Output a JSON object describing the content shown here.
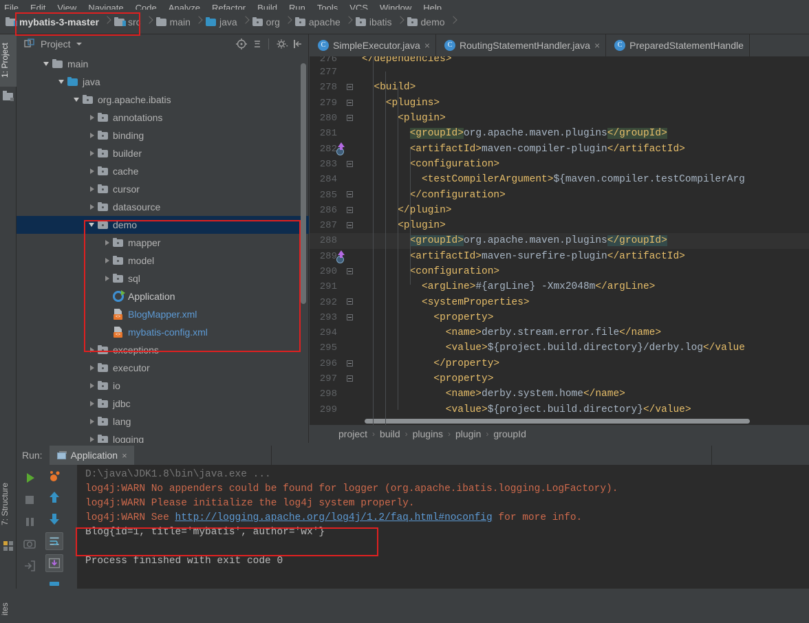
{
  "menubar": {
    "items": [
      "File",
      "Edit",
      "View",
      "Navigate",
      "Code",
      "Analyze",
      "Refactor",
      "Build",
      "Run",
      "Tools",
      "VCS",
      "Window",
      "Help"
    ]
  },
  "navbar": {
    "crumbs": [
      {
        "label": "mybatis-3-master",
        "icon": "module-folder-icon"
      },
      {
        "label": "src",
        "icon": "source-folder-icon"
      },
      {
        "label": "main",
        "icon": "folder-icon"
      },
      {
        "label": "java",
        "icon": "source-root-folder-icon"
      },
      {
        "label": "org",
        "icon": "package-icon"
      },
      {
        "label": "apache",
        "icon": "package-icon"
      },
      {
        "label": "ibatis",
        "icon": "package-icon"
      },
      {
        "label": "demo",
        "icon": "package-icon"
      }
    ]
  },
  "left_strip": {
    "project_tab": "1: Project",
    "structure_tab": "7: Structure",
    "favorites_tab": "ites"
  },
  "project_panel": {
    "title": "Project",
    "toolbar_icons": [
      "locate-target-icon",
      "collapse-all-icon",
      "settings-gear-icon",
      "hide-panel-icon"
    ],
    "tree": [
      {
        "label": "main",
        "indent": 1,
        "twist": "open",
        "icon": "folder-icon",
        "kind": "folder"
      },
      {
        "label": "java",
        "indent": 2,
        "twist": "open",
        "icon": "source-root-folder-icon",
        "kind": "sourceroot"
      },
      {
        "label": "org.apache.ibatis",
        "indent": 3,
        "twist": "open",
        "icon": "package-icon",
        "kind": "package"
      },
      {
        "label": "annotations",
        "indent": 4,
        "twist": "closed",
        "icon": "package-icon",
        "kind": "package"
      },
      {
        "label": "binding",
        "indent": 4,
        "twist": "closed",
        "icon": "package-icon",
        "kind": "package"
      },
      {
        "label": "builder",
        "indent": 4,
        "twist": "closed",
        "icon": "package-icon",
        "kind": "package"
      },
      {
        "label": "cache",
        "indent": 4,
        "twist": "closed",
        "icon": "package-icon",
        "kind": "package"
      },
      {
        "label": "cursor",
        "indent": 4,
        "twist": "closed",
        "icon": "package-icon",
        "kind": "package"
      },
      {
        "label": "datasource",
        "indent": 4,
        "twist": "closed",
        "icon": "package-icon",
        "kind": "package"
      },
      {
        "label": "demo",
        "indent": 4,
        "twist": "open",
        "icon": "package-icon",
        "kind": "package",
        "selected": true
      },
      {
        "label": "mapper",
        "indent": 5,
        "twist": "closed",
        "icon": "package-icon",
        "kind": "package"
      },
      {
        "label": "model",
        "indent": 5,
        "twist": "closed",
        "icon": "package-icon",
        "kind": "package"
      },
      {
        "label": "sql",
        "indent": 5,
        "twist": "closed",
        "icon": "package-icon",
        "kind": "package"
      },
      {
        "label": "Application",
        "indent": 5,
        "twist": "none",
        "icon": "java-class-run-icon",
        "kind": "class"
      },
      {
        "label": "BlogMapper.xml",
        "indent": 5,
        "twist": "none",
        "icon": "xml-file-icon",
        "kind": "xml"
      },
      {
        "label": "mybatis-config.xml",
        "indent": 5,
        "twist": "none",
        "icon": "xml-file-icon",
        "kind": "xml"
      },
      {
        "label": "exceptions",
        "indent": 4,
        "twist": "closed",
        "icon": "package-icon",
        "kind": "package"
      },
      {
        "label": "executor",
        "indent": 4,
        "twist": "closed",
        "icon": "package-icon",
        "kind": "package"
      },
      {
        "label": "io",
        "indent": 4,
        "twist": "closed",
        "icon": "package-icon",
        "kind": "package"
      },
      {
        "label": "jdbc",
        "indent": 4,
        "twist": "closed",
        "icon": "package-icon",
        "kind": "package"
      },
      {
        "label": "lang",
        "indent": 4,
        "twist": "closed",
        "icon": "package-icon",
        "kind": "package"
      },
      {
        "label": "logging",
        "indent": 4,
        "twist": "closed",
        "icon": "package-icon",
        "kind": "package"
      }
    ]
  },
  "editor": {
    "tabs": [
      {
        "label": "SimpleExecutor.java",
        "icon": "java-class-icon",
        "active": false
      },
      {
        "label": "RoutingStatementHandler.java",
        "icon": "java-class-icon",
        "active": false
      },
      {
        "label": "PreparedStatementHandle",
        "icon": "java-class-icon",
        "active": false
      }
    ],
    "breadcrumb": [
      "project",
      "build",
      "plugins",
      "plugin",
      "groupId"
    ],
    "lines": [
      {
        "num": "276",
        "indent": 0,
        "text": "</dependencies>",
        "clipped_top": true
      },
      {
        "num": "277",
        "indent": 0,
        "text": ""
      },
      {
        "num": "278",
        "indent": 2,
        "text": "<build>"
      },
      {
        "num": "279",
        "indent": 4,
        "text": "<plugins>"
      },
      {
        "num": "280",
        "indent": 6,
        "text": "<plugin>"
      },
      {
        "num": "281",
        "indent": 8,
        "text": "<groupId>org.apache.maven.plugins</groupId>",
        "highlight_tag": true
      },
      {
        "num": "282",
        "indent": 8,
        "text": "<artifactId>maven-compiler-plugin</artifactId>",
        "gutter": "override-marker"
      },
      {
        "num": "283",
        "indent": 8,
        "text": "<configuration>"
      },
      {
        "num": "284",
        "indent": 10,
        "text": "<testCompilerArgument>${maven.compiler.testCompilerArg"
      },
      {
        "num": "285",
        "indent": 8,
        "text": "</configuration>"
      },
      {
        "num": "286",
        "indent": 6,
        "text": "</plugin>"
      },
      {
        "num": "287",
        "indent": 6,
        "text": "<plugin>"
      },
      {
        "num": "288",
        "indent": 8,
        "text": "<groupId>org.apache.maven.plugins</groupId>",
        "current": true,
        "highlight_tag2": true
      },
      {
        "num": "289",
        "indent": 8,
        "text": "<artifactId>maven-surefire-plugin</artifactId>",
        "gutter": "override-marker"
      },
      {
        "num": "290",
        "indent": 8,
        "text": "<configuration>"
      },
      {
        "num": "291",
        "indent": 10,
        "text": "<argLine>#{argLine} -Xmx2048m</argLine>"
      },
      {
        "num": "292",
        "indent": 10,
        "text": "<systemProperties>"
      },
      {
        "num": "293",
        "indent": 12,
        "text": "<property>"
      },
      {
        "num": "294",
        "indent": 14,
        "text": "<name>derby.stream.error.file</name>"
      },
      {
        "num": "295",
        "indent": 14,
        "text": "<value>${project.build.directory}/derby.log</value"
      },
      {
        "num": "296",
        "indent": 12,
        "text": "</property>"
      },
      {
        "num": "297",
        "indent": 12,
        "text": "<property>"
      },
      {
        "num": "298",
        "indent": 14,
        "text": "<name>derby.system.home</name>"
      },
      {
        "num": "299",
        "indent": 14,
        "text": "<value>${project.build.directory}</value>"
      }
    ]
  },
  "run_panel": {
    "run_label": "Run:",
    "tab_label": "Application",
    "tab_close": "×",
    "toolbar_icons": [
      "rerun-play-icon",
      "stop-icon",
      "pause-icon",
      "camera-dump-icon",
      "exit-icon",
      "coverage-icon",
      "scroll-up-icon",
      "scroll-down-icon",
      "soft-wrap-icon",
      "scroll-to-end-icon",
      "print-icon"
    ],
    "console": [
      {
        "text": "D:\\java\\JDK1.8\\bin\\java.exe ...",
        "style": "dim"
      },
      {
        "text": "log4j:WARN No appenders could be found for logger (org.apache.ibatis.logging.LogFactory).",
        "style": "err"
      },
      {
        "text": "log4j:WARN Please initialize the log4j system properly.",
        "style": "err"
      },
      {
        "text": "log4j:WARN See ",
        "style": "err",
        "link": "http://logging.apache.org/log4j/1.2/faq.html#noconfig",
        "after": " for more info."
      },
      {
        "text": "Blog{id=1, title='mybatis', author='wx'}",
        "style": "out"
      },
      {
        "text": "",
        "style": "out"
      },
      {
        "text": "Process finished with exit code 0",
        "style": "out"
      }
    ]
  },
  "annotations": {
    "boxes": [
      {
        "name": "project-root-highlight"
      },
      {
        "name": "demo-package-highlight"
      },
      {
        "name": "console-output-highlight"
      }
    ]
  },
  "colors": {
    "bg_panel": "#3c3f41",
    "bg_editor": "#2b2b2b",
    "selection": "#0d2c4e",
    "accent_blue": "#3592c4",
    "xml_tag": "#e8bf6a",
    "text": "#a9b7c6",
    "error_red": "#cf6a4c",
    "annotation_red": "#e02020"
  }
}
